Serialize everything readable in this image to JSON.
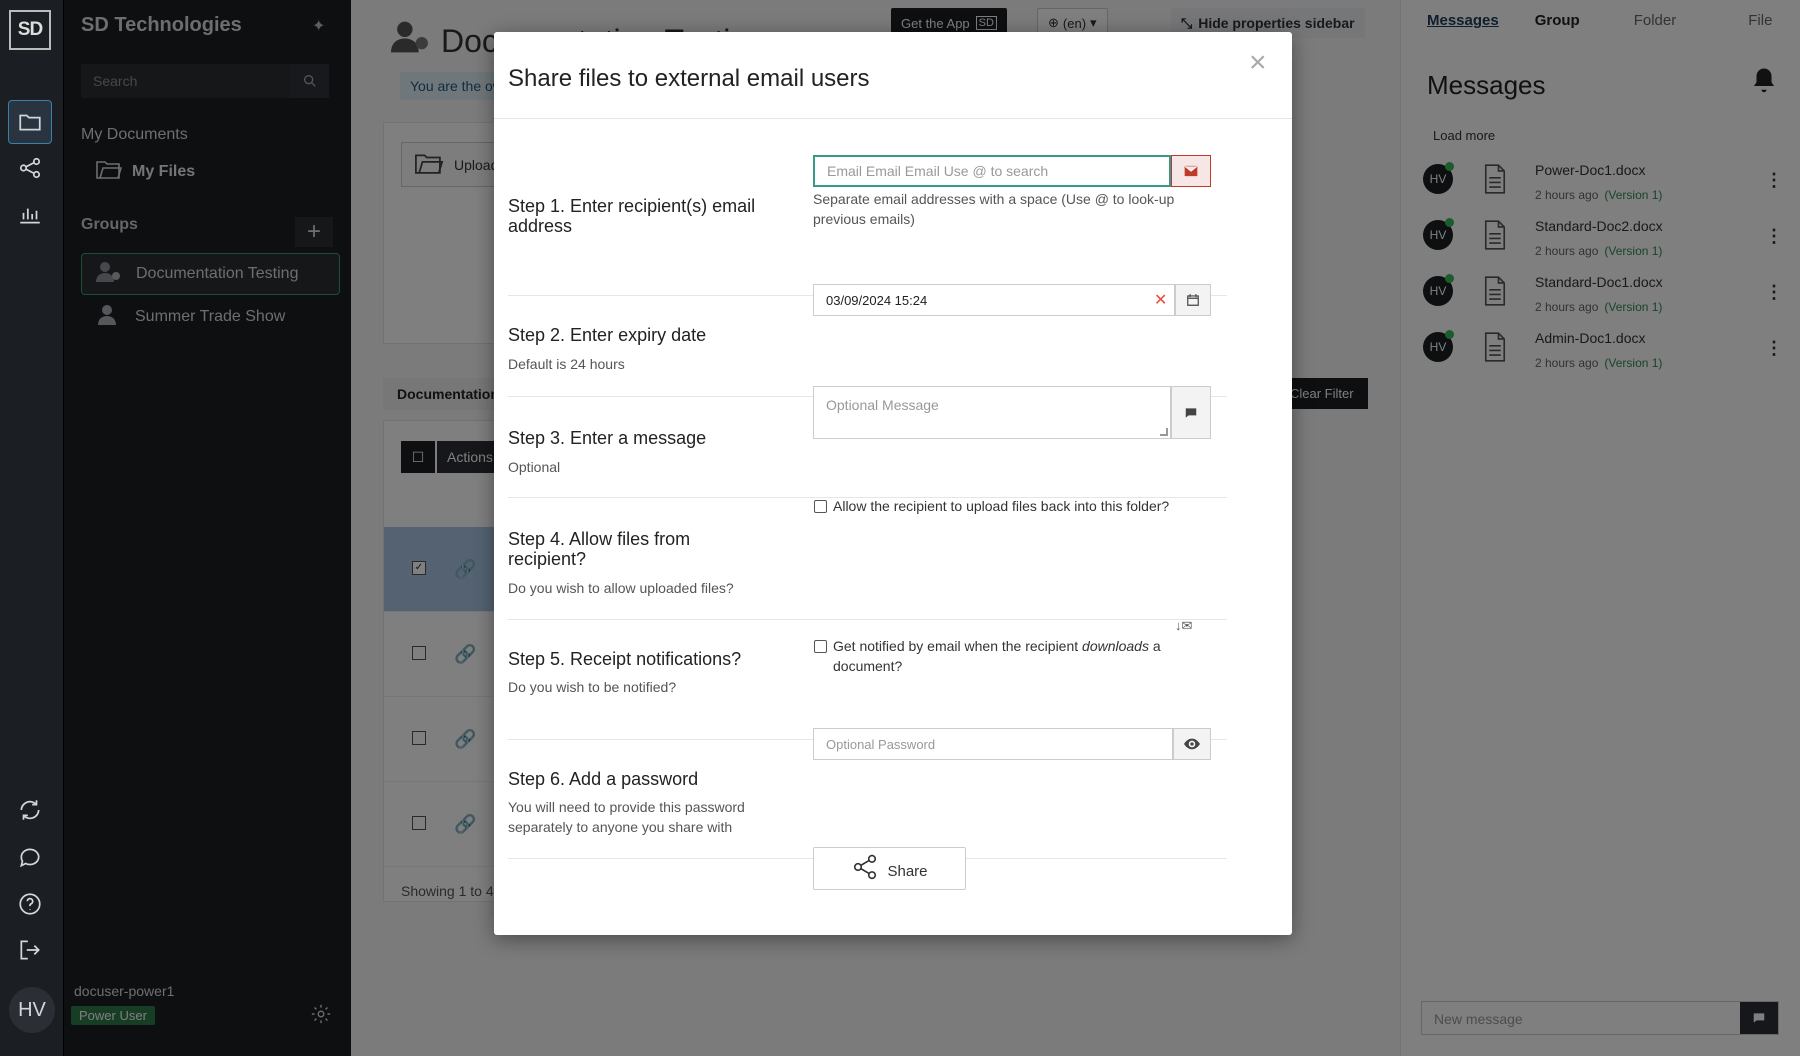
{
  "rail": {
    "logo": "SD",
    "avatar_initials": "HV"
  },
  "sidebar": {
    "brand": "SD Technologies",
    "search_placeholder": "Search",
    "my_documents": "My Documents",
    "my_files": "My Files",
    "groups_heading": "Groups",
    "groups": [
      {
        "label": "Documentation Testing"
      },
      {
        "label": "Summer Trade Show"
      }
    ],
    "username": "docuser-power1",
    "role": "Power User"
  },
  "main": {
    "title": "Documentation Testing",
    "owner_badge": "You are the owner",
    "get_app": "Get the App",
    "get_app_logo": "SD",
    "lang": "(en)",
    "hide_props": "Hide properties sidebar",
    "upload": "Upload",
    "doc_tab": "Documentation Testing",
    "filter": "Clear Filter",
    "actions": "Actions",
    "showing": "Showing 1 to 4"
  },
  "right_panel": {
    "tabs": [
      {
        "label": "Messages",
        "active": true
      },
      {
        "label": "Group",
        "active": false
      },
      {
        "label": "Folder",
        "active": false
      },
      {
        "label": "File",
        "active": false
      }
    ],
    "title": "Messages",
    "load_more": "Load more",
    "messages": [
      {
        "initials": "HV",
        "file": "Power-Doc1.docx",
        "time": "2 hours ago",
        "version": "(Version 1)"
      },
      {
        "initials": "HV",
        "file": "Standard-Doc2.docx",
        "time": "2 hours ago",
        "version": "(Version 1)"
      },
      {
        "initials": "HV",
        "file": "Standard-Doc1.docx",
        "time": "2 hours ago",
        "version": "(Version 1)"
      },
      {
        "initials": "HV",
        "file": "Admin-Doc1.docx",
        "time": "2 hours ago",
        "version": "(Version 1)"
      }
    ],
    "new_message_placeholder": "New message"
  },
  "modal": {
    "title": "Share files to external email users",
    "close": "×",
    "step1": {
      "title": "Step 1. Enter recipient(s) email address",
      "placeholder": "Email Email Email   Use @ to search",
      "help": "Separate email addresses with a space (Use @ to look-up previous emails)"
    },
    "step2": {
      "title": "Step 2. Enter expiry date",
      "sub": "Default is 24 hours",
      "value": "03/09/2024 15:24"
    },
    "step3": {
      "title": "Step 3. Enter a message",
      "sub": "Optional",
      "placeholder": "Optional Message"
    },
    "step4": {
      "title": "Step 4. Allow files from recipient?",
      "sub": "Do you wish to allow uploaded files?",
      "checkbox_label": "Allow the recipient to upload files back into this folder?"
    },
    "step5": {
      "title": "Step 5. Receipt notifications?",
      "sub": "Do you wish to be notified?",
      "checkbox_label_pre": "Get notified by email when the recipient ",
      "checkbox_label_em": "downloads",
      "checkbox_label_post": " a document?"
    },
    "step6": {
      "title": "Step 6. Add a password",
      "sub": "You will need to provide this password separately to anyone you share with",
      "placeholder": "Optional Password"
    },
    "share_button": "Share"
  }
}
